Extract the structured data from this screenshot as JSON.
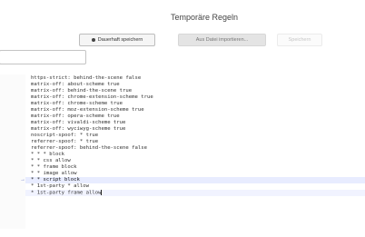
{
  "header": {
    "title": "Temporäre Regeln"
  },
  "toolbar": {
    "save_label": "Dauerhaft speichern",
    "import_label": "Aus Datei importieren...",
    "apply_label": "Speichern"
  },
  "filter": {
    "value": "",
    "placeholder": ""
  },
  "editor": {
    "lines": [
      "https-strict: behind-the-scene false",
      "matrix-off: about-scheme true",
      "matrix-off: behind-the-scene true",
      "matrix-off: chrome-extension-scheme true",
      "matrix-off: chrome-scheme true",
      "matrix-off: moz-extension-scheme true",
      "matrix-off: opera-scheme true",
      "matrix-off: vivaldi-scheme true",
      "matrix-off: wyciwyg-scheme true",
      "noscript-spoof: * true",
      "referrer-spoof: * true",
      "referrer-spoof: behind-the-scene false",
      "* * * block",
      "* * css allow",
      "* * frame block",
      "* * image allow",
      "* * script block",
      "* 1st-party * allow",
      "* 1st-party frame allow"
    ],
    "highlighted_line_index": 16,
    "cursor_line_index": 18
  },
  "icons": {
    "changed_line_marker": "arrow-right-icon",
    "save_icon": "dot-icon"
  }
}
